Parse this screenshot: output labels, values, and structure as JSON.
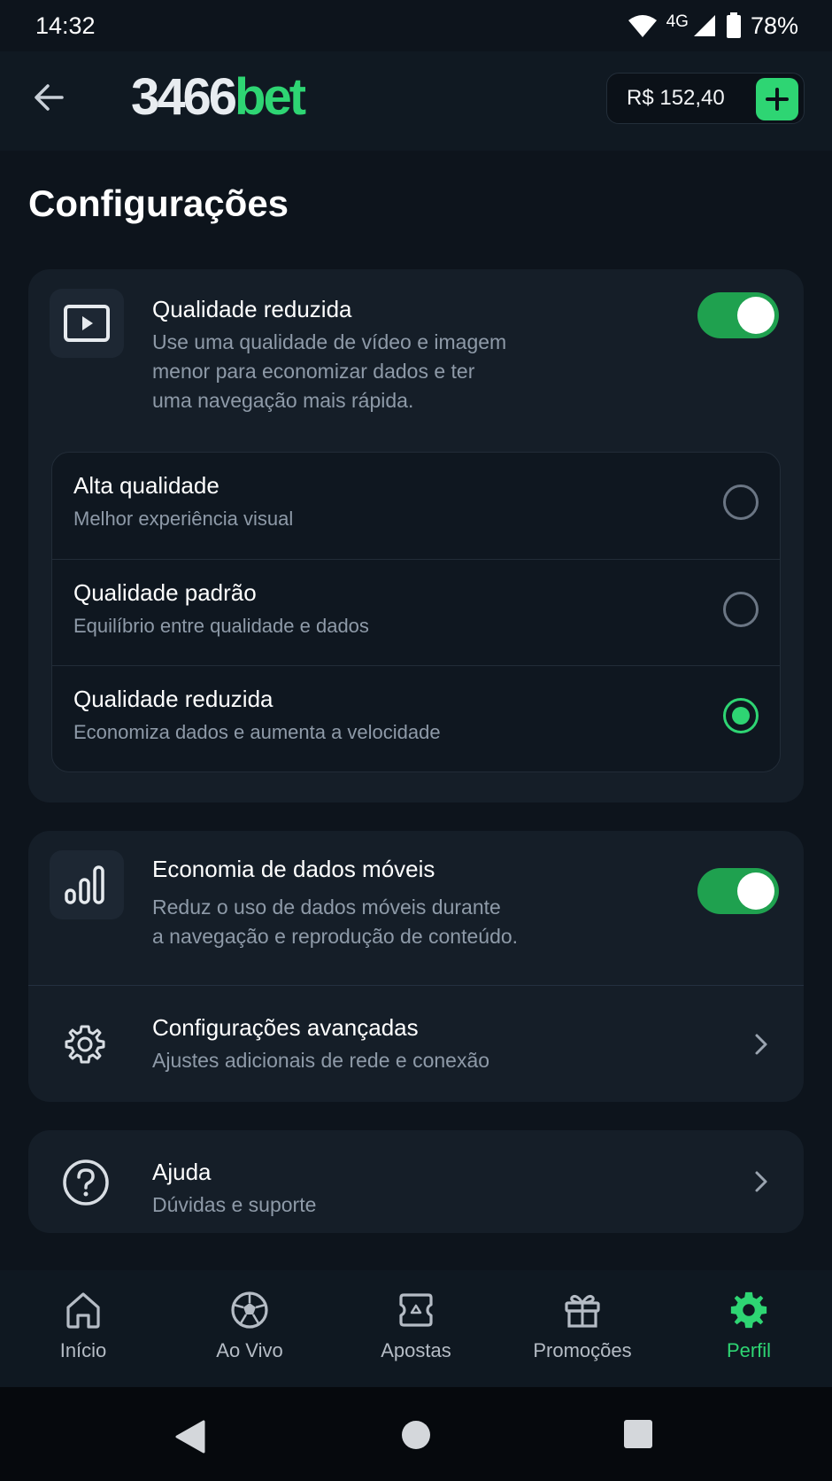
{
  "status": {
    "time": "14:32",
    "network": "4G",
    "battery": "78%"
  },
  "header": {
    "logo_number": "3466",
    "logo_bet": "bet",
    "balance": "R$ 152,40"
  },
  "page": {
    "title": "Configurações"
  },
  "video_quality": {
    "title": "Qualidade reduzida",
    "description_lines": [
      "Use uma qualidade de vídeo e imagem",
      "menor para economizar dados e ter",
      "uma navegação mais rápida."
    ],
    "toggle_on": true,
    "options": [
      {
        "title": "Alta qualidade",
        "description": "Melhor experiência visual",
        "selected": false
      },
      {
        "title": "Qualidade padrão",
        "description": "Equilíbrio entre qualidade e dados",
        "selected": false
      },
      {
        "title": "Qualidade reduzida",
        "description": "Economiza dados e aumenta a velocidade",
        "selected": true
      }
    ]
  },
  "data_saver": {
    "title": "Economia de dados móveis",
    "description_lines": [
      "Reduz o uso de dados móveis durante",
      "a navegação e reprodução de conteúdo."
    ],
    "toggle_on": true
  },
  "advanced": {
    "title": "Configurações avançadas",
    "description": "Ajustes adicionais de rede e conexão"
  },
  "help": {
    "title": "Ajuda",
    "description": "Dúvidas e suporte"
  },
  "bottom_nav": {
    "items": [
      {
        "label": "Início",
        "icon": "home-icon",
        "active": false
      },
      {
        "label": "Ao Vivo",
        "icon": "soccer-ball-icon",
        "active": false
      },
      {
        "label": "Apostas",
        "icon": "ticket-icon",
        "active": false
      },
      {
        "label": "Promoções",
        "icon": "gift-icon",
        "active": false
      },
      {
        "label": "Perfil",
        "icon": "gear-icon",
        "active": true
      }
    ]
  },
  "colors": {
    "accent": "#2ed573",
    "background": "#0d141c",
    "card": "#151e28"
  }
}
